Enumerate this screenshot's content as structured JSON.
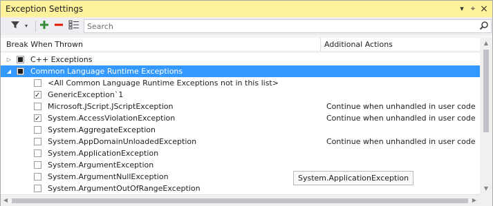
{
  "window": {
    "title": "Exception Settings",
    "controls": [
      {
        "icon": "dropdown-arrow-icon",
        "glyph": "▾"
      },
      {
        "icon": "pin-icon",
        "glyph": "⌖"
      },
      {
        "icon": "close-icon",
        "glyph": "×"
      }
    ]
  },
  "toolbar": {
    "search_placeholder": "Search",
    "tools": [
      "filter-icon",
      "dropdown-arrow-icon",
      "add-icon",
      "remove-icon",
      "restore-defaults-icon"
    ]
  },
  "columns": {
    "break_when_thrown": "Break When Thrown",
    "additional_actions": "Additional Actions"
  },
  "rows": [
    {
      "label": "C++ Exceptions",
      "level": 0,
      "expander": "▷",
      "state": "partial",
      "action": "",
      "selected": false
    },
    {
      "label": "Common Language Runtime Exceptions",
      "level": 0,
      "expander": "◢",
      "state": "partial",
      "action": "",
      "selected": true
    },
    {
      "label": "<All Common Language Runtime Exceptions not in this list>",
      "level": 1,
      "expander": "",
      "state": "unchecked",
      "action": "",
      "selected": false
    },
    {
      "label": "GenericException`1",
      "level": 1,
      "expander": "",
      "state": "checked",
      "action": "",
      "selected": false
    },
    {
      "label": "Microsoft.JScript.JScriptException",
      "level": 1,
      "expander": "",
      "state": "unchecked",
      "action": "Continue when unhandled in user code",
      "selected": false
    },
    {
      "label": "System.AccessViolationException",
      "level": 1,
      "expander": "",
      "state": "checked",
      "action": "Continue when unhandled in user code",
      "selected": false
    },
    {
      "label": "System.AggregateException",
      "level": 1,
      "expander": "",
      "state": "unchecked",
      "action": "",
      "selected": false
    },
    {
      "label": "System.AppDomainUnloadedException",
      "level": 1,
      "expander": "",
      "state": "unchecked",
      "action": "Continue when unhandled in user code",
      "selected": false
    },
    {
      "label": "System.ApplicationException",
      "level": 1,
      "expander": "",
      "state": "unchecked",
      "action": "",
      "selected": false
    },
    {
      "label": "System.ArgumentException",
      "level": 1,
      "expander": "",
      "state": "unchecked",
      "action": "",
      "selected": false
    },
    {
      "label": "System.ArgumentNullException",
      "level": 1,
      "expander": "",
      "state": "unchecked",
      "action": "",
      "selected": false
    },
    {
      "label": "System.ArgumentOutOfRangeException",
      "level": 1,
      "expander": "",
      "state": "unchecked",
      "action": "",
      "selected": false
    }
  ],
  "tooltip": "System.ApplicationException",
  "colors": {
    "title_bar": "#fff29d",
    "selection": "#3399ff",
    "add_green": "#388a34",
    "remove_red": "#e51400"
  }
}
